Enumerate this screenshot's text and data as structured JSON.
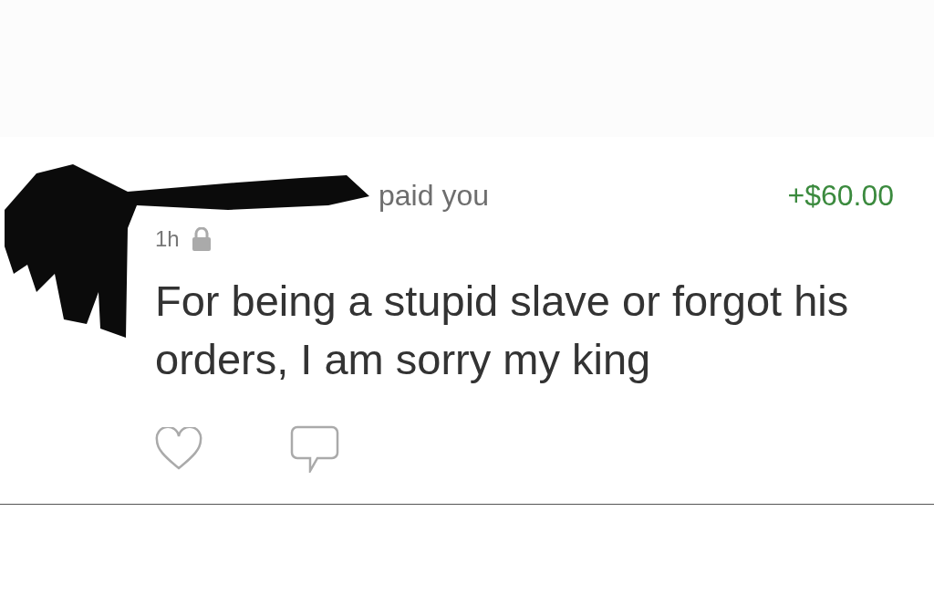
{
  "payment": {
    "action": "paid you",
    "amount": "+$60.00",
    "time": "1h",
    "private": true,
    "message": "For being a stupid slave or forgot his orders, I am sorry my king"
  }
}
